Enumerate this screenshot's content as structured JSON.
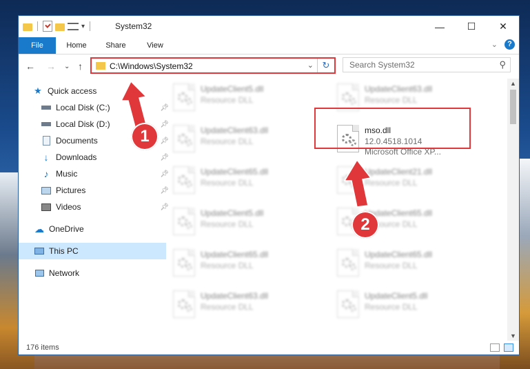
{
  "window": {
    "title": "System32",
    "controls": {
      "minimize": "—",
      "maximize": "☐",
      "close": "✕"
    }
  },
  "ribbon": {
    "tabs": [
      "File",
      "Home",
      "Share",
      "View"
    ]
  },
  "navigation": {
    "address": "C:\\Windows\\System32",
    "search_placeholder": "Search System32"
  },
  "sidebar": {
    "quick_access": "Quick access",
    "items": [
      {
        "label": "Local Disk (C:)",
        "icon": "drive-icon",
        "pinned": true
      },
      {
        "label": "Local Disk (D:)",
        "icon": "drive-icon",
        "pinned": true
      },
      {
        "label": "Documents",
        "icon": "documents-icon",
        "pinned": true
      },
      {
        "label": "Downloads",
        "icon": "downloads-icon",
        "pinned": true
      },
      {
        "label": "Music",
        "icon": "music-icon",
        "pinned": true
      },
      {
        "label": "Pictures",
        "icon": "pictures-icon",
        "pinned": true
      },
      {
        "label": "Videos",
        "icon": "videos-icon",
        "pinned": true
      }
    ],
    "onedrive": "OneDrive",
    "this_pc": "This PC",
    "network": "Network"
  },
  "files": {
    "left": [
      {
        "name": "UpdateClient5.dll",
        "type": "Resource DLL"
      },
      {
        "name": "UpdateClient63.dll",
        "type": "Resource DLL"
      },
      {
        "name": "UpdateClient65.dll",
        "type": "Resource DLL"
      },
      {
        "name": "UpdateClient5.dll",
        "type": "Resource DLL"
      },
      {
        "name": "UpdateClient65.dll",
        "type": "Resource DLL"
      },
      {
        "name": "UpdateClient63.dll",
        "type": "Resource DLL"
      }
    ],
    "right": [
      {
        "name": "UpdateClient63.dll",
        "type": "Resource DLL"
      },
      {
        "name": "UpdateClient21.dll",
        "type": "Resource DLL"
      },
      {
        "name": "UpdateClient65.dll",
        "type": "Resource DLL"
      },
      {
        "name": "UpdateClient65.dll",
        "type": "Resource DLL"
      },
      {
        "name": "UpdateClient5.dll",
        "type": "Resource DLL"
      }
    ],
    "highlighted": {
      "name": "mso.dll",
      "version": "12.0.4518.1014",
      "description": "Microsoft Office XP..."
    }
  },
  "status": {
    "count": "176 items"
  },
  "annotations": {
    "step1": "1",
    "step2": "2"
  },
  "colors": {
    "accent": "#1979ca",
    "highlight": "#e0373a"
  }
}
